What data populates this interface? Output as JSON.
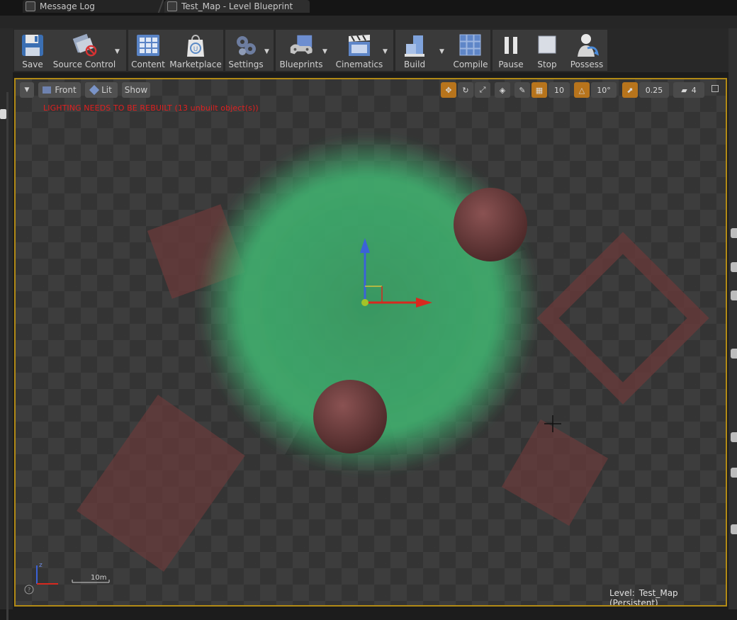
{
  "tabs": [
    {
      "label": "Message Log"
    },
    {
      "label": "Test_Map - Level Blueprint"
    }
  ],
  "toolbar": {
    "buttons": [
      {
        "label": "Save",
        "icon": "save-icon"
      },
      {
        "label": "Source Control",
        "icon": "source-control-icon"
      },
      {
        "label": "Content",
        "icon": "content-icon"
      },
      {
        "label": "Marketplace",
        "icon": "marketplace-icon"
      },
      {
        "label": "Settings",
        "icon": "settings-icon"
      },
      {
        "label": "Blueprints",
        "icon": "blueprints-icon"
      },
      {
        "label": "Cinematics",
        "icon": "cinematics-icon"
      },
      {
        "label": "Build",
        "icon": "build-icon"
      },
      {
        "label": "Compile",
        "icon": "compile-icon"
      },
      {
        "label": "Pause",
        "icon": "pause-icon"
      },
      {
        "label": "Stop",
        "icon": "stop-icon"
      },
      {
        "label": "Possess",
        "icon": "possess-icon"
      }
    ]
  },
  "viewport": {
    "view_mode": "Front",
    "lighting": "Lit",
    "show": "Show",
    "warning": "LIGHTING NEEDS TO BE REBUILT (13 unbuilt object(s))",
    "grid_snap": "10",
    "rotation_snap": "10°",
    "scale_snap": "0.25",
    "camera_speed": "4",
    "scale_bar": "10m",
    "level_prefix": "Level:",
    "level_name": "Test_Map (Persistent)"
  },
  "colors": {
    "accent": "#b28a15",
    "warning": "#e02020",
    "fog": "#3fae6e",
    "mesh": "#6a3a3a"
  }
}
